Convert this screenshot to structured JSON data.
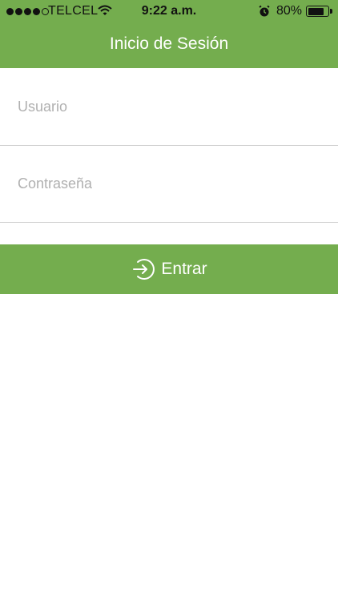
{
  "status_bar": {
    "carrier": "TELCEL",
    "time": "9:22 a.m.",
    "battery_percent": "80%",
    "battery_level": 0.8,
    "signal_bars_filled": 4,
    "signal_bars_total": 5
  },
  "nav": {
    "title": "Inicio de Sesión"
  },
  "form": {
    "username_placeholder": "Usuario",
    "password_placeholder": "Contraseña",
    "submit_label": "Entrar"
  },
  "colors": {
    "brand": "#74ad4e",
    "text_on_brand": "#ffffff",
    "placeholder": "#b0b0b0",
    "divider": "#d0d0d0"
  },
  "icons": {
    "submit": "enter-icon",
    "status": [
      "signal-icon",
      "wifi-icon",
      "alarm-icon",
      "battery-icon"
    ]
  }
}
